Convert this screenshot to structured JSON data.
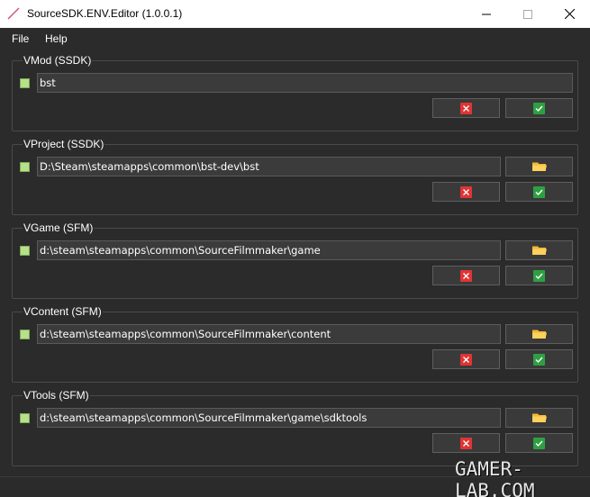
{
  "window": {
    "title": "SourceSDK.ENV.Editor (1.0.0.1)"
  },
  "menu": {
    "file": "File",
    "help": "Help"
  },
  "groups": [
    {
      "title": "VMod (SSDK)",
      "value": "bst",
      "enabled": true
    },
    {
      "title": "VProject (SSDK)",
      "value": "D:\\Steam\\steamapps\\common\\bst-dev\\bst",
      "enabled": true
    },
    {
      "title": "VGame (SFM)",
      "value": "d:\\steam\\steamapps\\common\\SourceFilmmaker\\game",
      "enabled": true
    },
    {
      "title": "VContent (SFM)",
      "value": "d:\\steam\\steamapps\\common\\SourceFilmmaker\\content",
      "enabled": true
    },
    {
      "title": "VTools (SFM)",
      "value": "d:\\steam\\steamapps\\common\\SourceFilmmaker\\game\\sdktools",
      "enabled": true
    }
  ],
  "watermark": "GAMER-LAB.COM",
  "colors": {
    "background": "#2b2b2b",
    "cancel": "#e03434",
    "accept": "#2ea043",
    "folder": "#f5b731",
    "checkbox": "#b8e08a"
  },
  "icons": {
    "cancel": "x-icon",
    "accept": "checkmark-icon",
    "browse": "folder-icon"
  }
}
